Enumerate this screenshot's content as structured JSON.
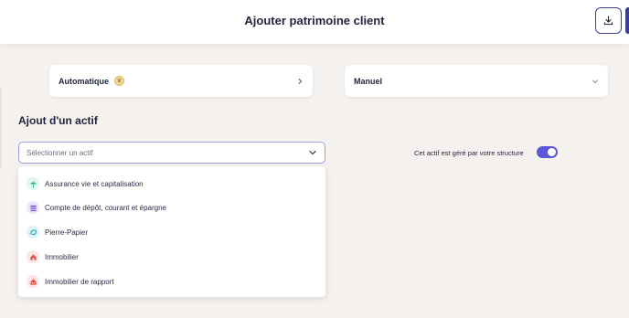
{
  "header": {
    "title": "Ajouter patrimoine client"
  },
  "cards": {
    "automatic": {
      "label": "Automatique"
    },
    "manual": {
      "label": "Manuel"
    }
  },
  "section": {
    "title": "Ajout d'un actif"
  },
  "select": {
    "placeholder": "Sélectionner un actif"
  },
  "options": [
    {
      "label": "Assurance vie et capitalisation",
      "icon": "umbrella-icon",
      "color": "#2eb88a",
      "bg": "#e2f6ee"
    },
    {
      "label": "Compte de dépôt, courant et épargne",
      "icon": "bank-icon",
      "color": "#7b5fd6",
      "bg": "#ece7fa"
    },
    {
      "label": "Pierre-Papier",
      "icon": "paper-icon",
      "color": "#2aa7b5",
      "bg": "#e0f4f6"
    },
    {
      "label": "Immobilier",
      "icon": "house-icon",
      "color": "#e0524f",
      "bg": "#fbe6e5"
    },
    {
      "label": "Immobilier de rapport",
      "icon": "building-icon",
      "color": "#e0524f",
      "bg": "#fbe6e5"
    }
  ],
  "toggle": {
    "label": "Cet actif est géré par votre structure",
    "on": true
  },
  "colors": {
    "accent": "#5b57d8",
    "navy": "#1f2340",
    "background": "#f4f1ef"
  }
}
